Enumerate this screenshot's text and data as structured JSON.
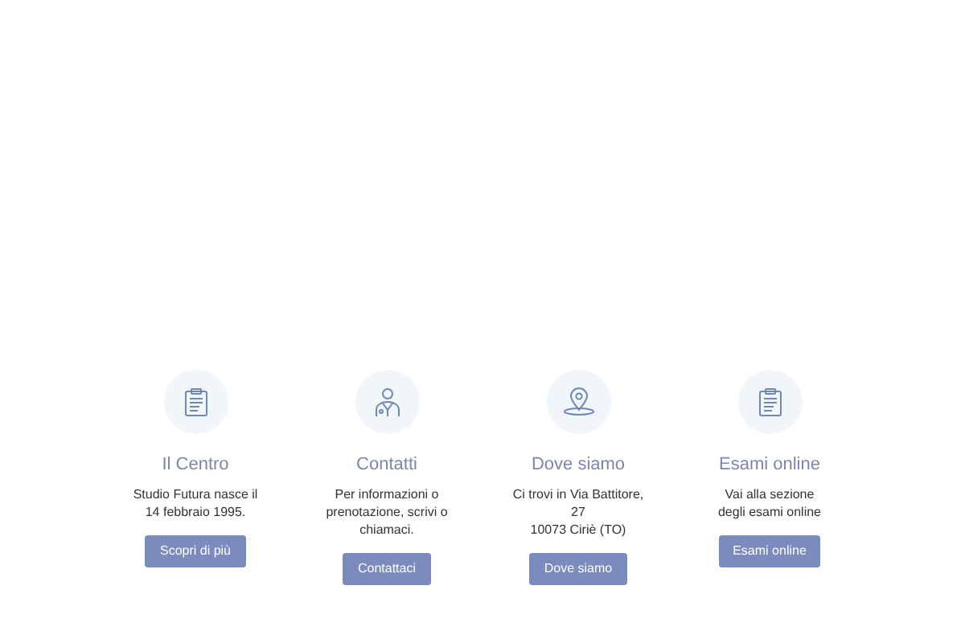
{
  "features": [
    {
      "title": "Il Centro",
      "text": "Studio Futura nasce il\n14 febbraio 1995.",
      "button": "Scopri di più"
    },
    {
      "title": "Contatti",
      "text": "Per informazioni o\nprenotazione, scrivi o\nchiamaci.",
      "button": "Contattaci"
    },
    {
      "title": "Dove siamo",
      "text": "Ci trovi in Via Battitore,\n27\n10073 Ciriè (TO)",
      "button": "Dove siamo"
    },
    {
      "title": "Esami online",
      "text": "Vai alla sezione\ndegli esami online",
      "button": "Esami online"
    }
  ]
}
